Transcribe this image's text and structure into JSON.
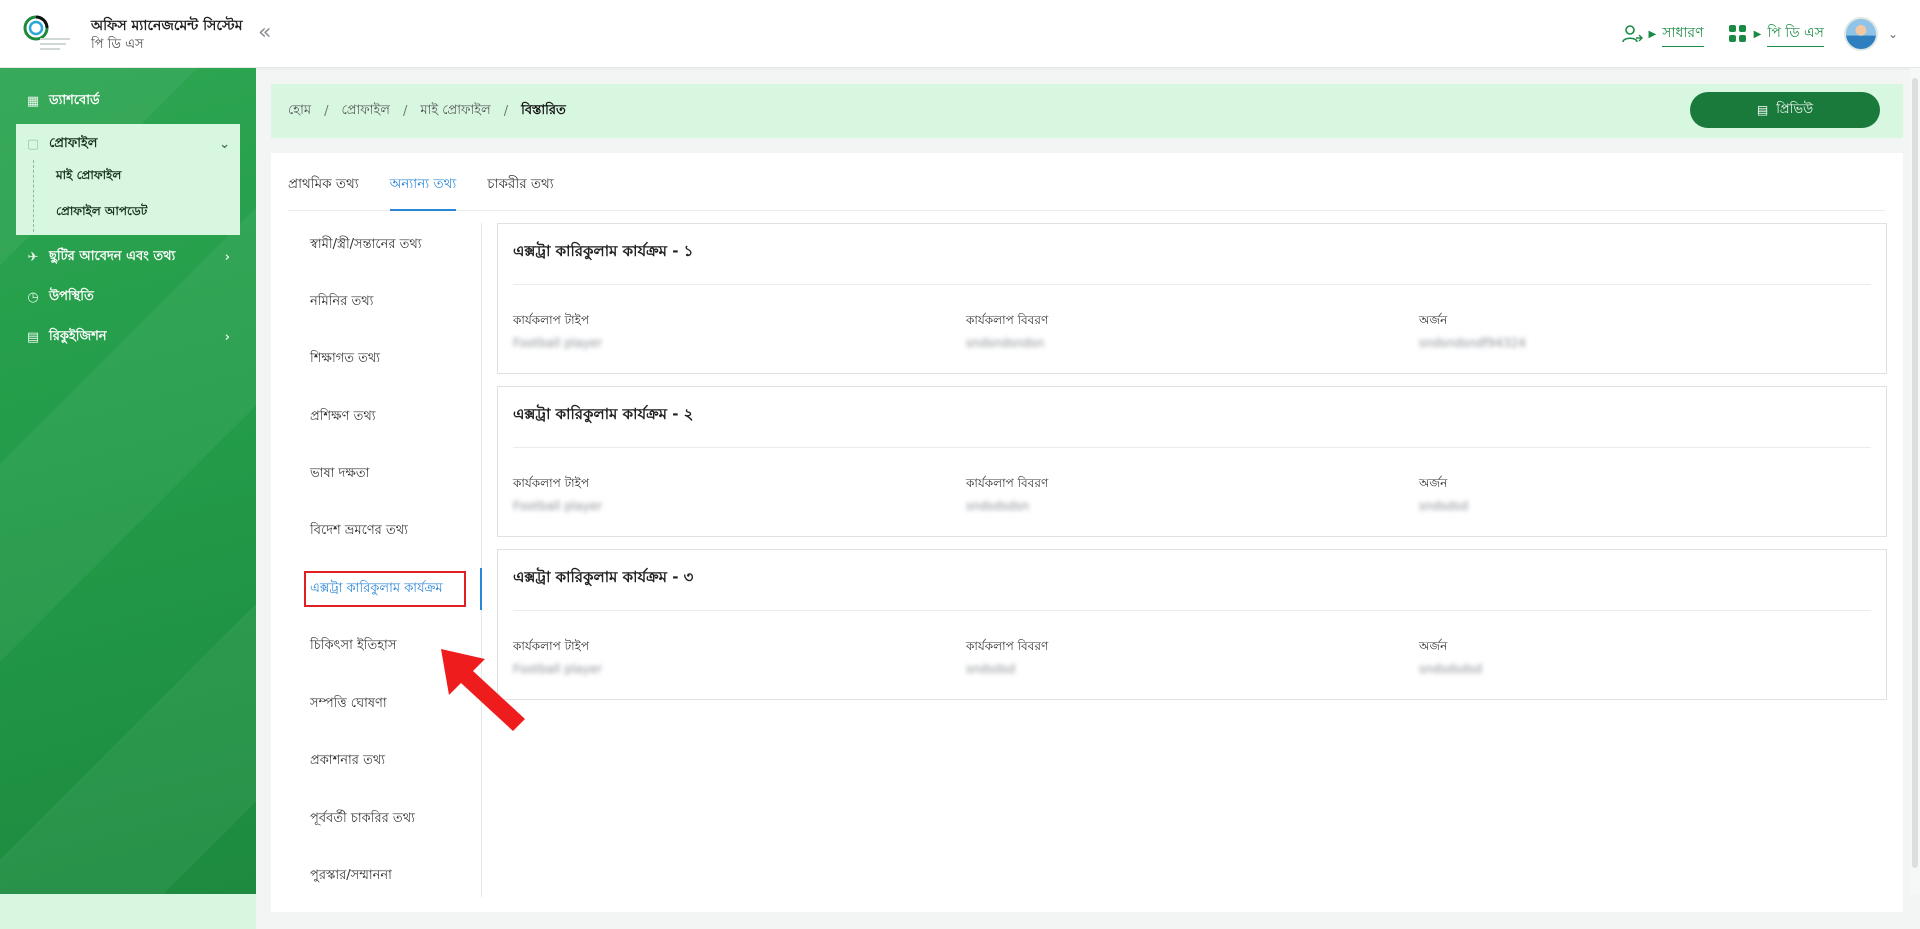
{
  "header": {
    "app_title": "অফিস ম্যানেজমেন্ট সিস্টেম",
    "app_subtitle": "পি ডি এস",
    "collapse_icon": "«",
    "role_link": "সাধারণ",
    "module_link": "পি ডি এস"
  },
  "sidebar": {
    "dashboard": "ড্যাশবোর্ড",
    "profile": "প্রোফাইল",
    "my_profile": "মাই প্রোফাইল",
    "profile_update": "প্রোফাইল আপডেট",
    "leave": "ছুটির আবেদন এবং তথ্য",
    "attendance": "উপস্থিতি",
    "requisition": "রিকুইজিশন"
  },
  "breadcrumb": {
    "home": "হোম",
    "profile": "প্রোফাইল",
    "my_profile": "মাই প্রোফাইল",
    "current": "বিস্তারিত"
  },
  "preview_button": "প্রিভিউ",
  "tabs": [
    "প্রাথমিক তথ্য",
    "অন্যান্য তথ্য",
    "চাকরীর তথ্য"
  ],
  "subnav": [
    "স্বামী/স্ত্রী/সন্তানের তথ্য",
    "নমিনির তথ্য",
    "শিক্ষাগত তথ্য",
    "প্রশিক্ষণ তথ্য",
    "ভাষা দক্ষতা",
    "বিদেশ ভ্রমণের তথ্য",
    "এক্সট্রা কারিকুলাম কার্যক্রম",
    "চিকিৎসা ইতিহাস",
    "সম্পত্তি ঘোষণা",
    "প্রকাশনার তথ্য",
    "পূর্ববর্তী চাকরির তথ্য",
    "পুরস্কার/সম্মাননা"
  ],
  "field_labels": {
    "type": "কার্যকলাপ টাইপ",
    "description": "কার্যকলাপ বিবরণ",
    "achievement": "অর্জন"
  },
  "activities": [
    {
      "title": "এক্সট্রা কারিকুলাম কার্যক্রম - ১",
      "type": "Football player",
      "description": "sndsndsndsn",
      "achievement": "sndsndsndf94324"
    },
    {
      "title": "এক্সট্রা কারিকুলাম কার্যক্রম - ২",
      "type": "Football player",
      "description": "sndsdsdsn",
      "achievement": "sndsdsd"
    },
    {
      "title": "এক্সট্রা কারিকুলাম কার্যক্রম - ৩",
      "type": "Football player",
      "description": "sndsdsd",
      "achievement": "sndsdsdsd"
    }
  ],
  "colors": {
    "sidebar": "#239c49",
    "accent_blue": "#2a86d6",
    "button_green": "#1a7a3c",
    "highlight_red": "#e02020"
  }
}
